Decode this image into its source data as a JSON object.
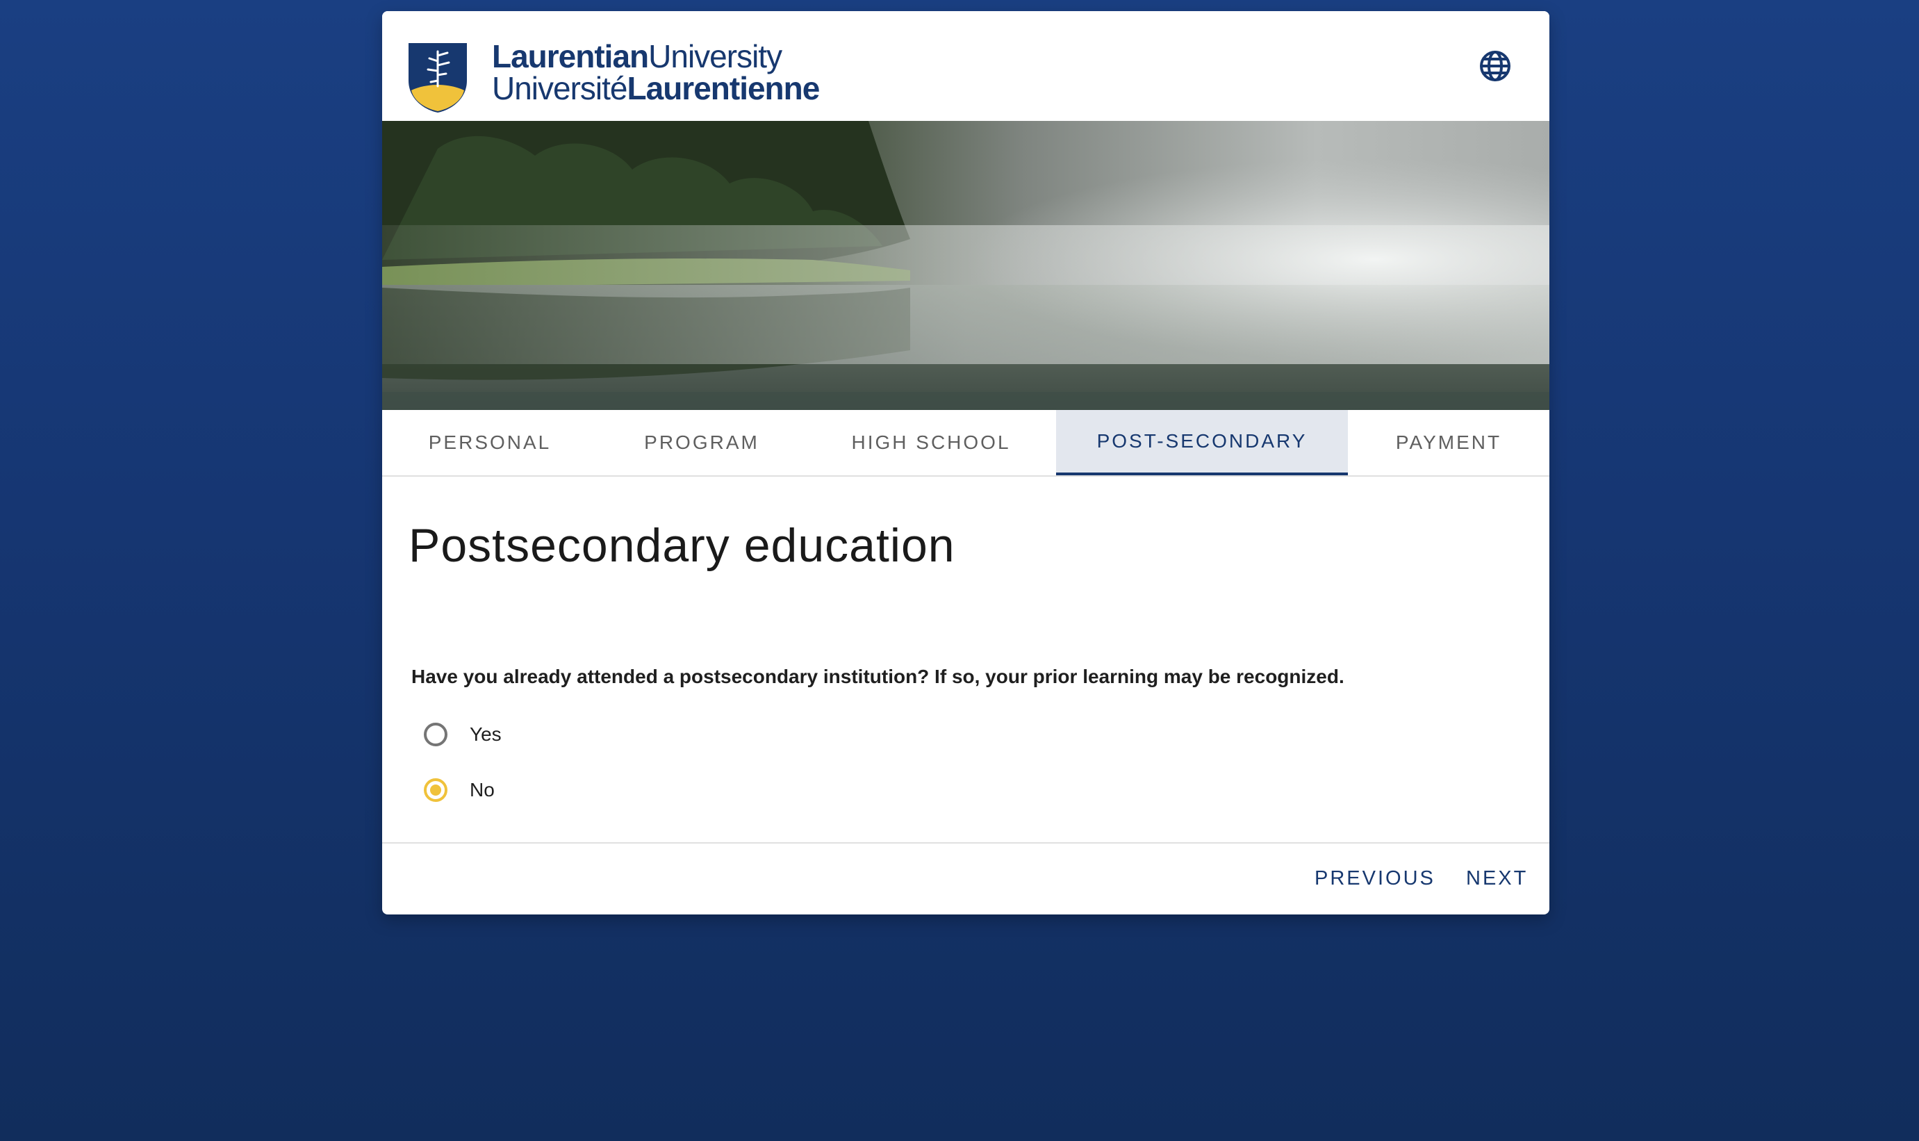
{
  "header": {
    "logo": {
      "line1_bold": "Laurentian",
      "line1_regular": "University",
      "line2_regular": "Université",
      "line2_bold": "Laurentienne"
    },
    "language_icon": "globe-icon"
  },
  "hero": {
    "image": "misty lake with forested shoreline"
  },
  "tabs": [
    {
      "label": "PERSONAL",
      "active": false
    },
    {
      "label": "PROGRAM",
      "active": false
    },
    {
      "label": "HIGH SCHOOL",
      "active": false
    },
    {
      "label": "POST-SECONDARY",
      "active": true
    },
    {
      "label": "PAYMENT",
      "active": false
    }
  ],
  "main": {
    "title": "Postsecondary education",
    "question": "Have you already attended a postsecondary institution? If so, your prior learning may be recognized.",
    "options": [
      {
        "label": "Yes",
        "selected": false
      },
      {
        "label": "No",
        "selected": true
      }
    ]
  },
  "footer": {
    "previous_label": "PREVIOUS",
    "next_label": "NEXT"
  },
  "colors": {
    "brand_navy": "#17386f",
    "accent_gold": "#f0c23b",
    "background": "#163672"
  }
}
